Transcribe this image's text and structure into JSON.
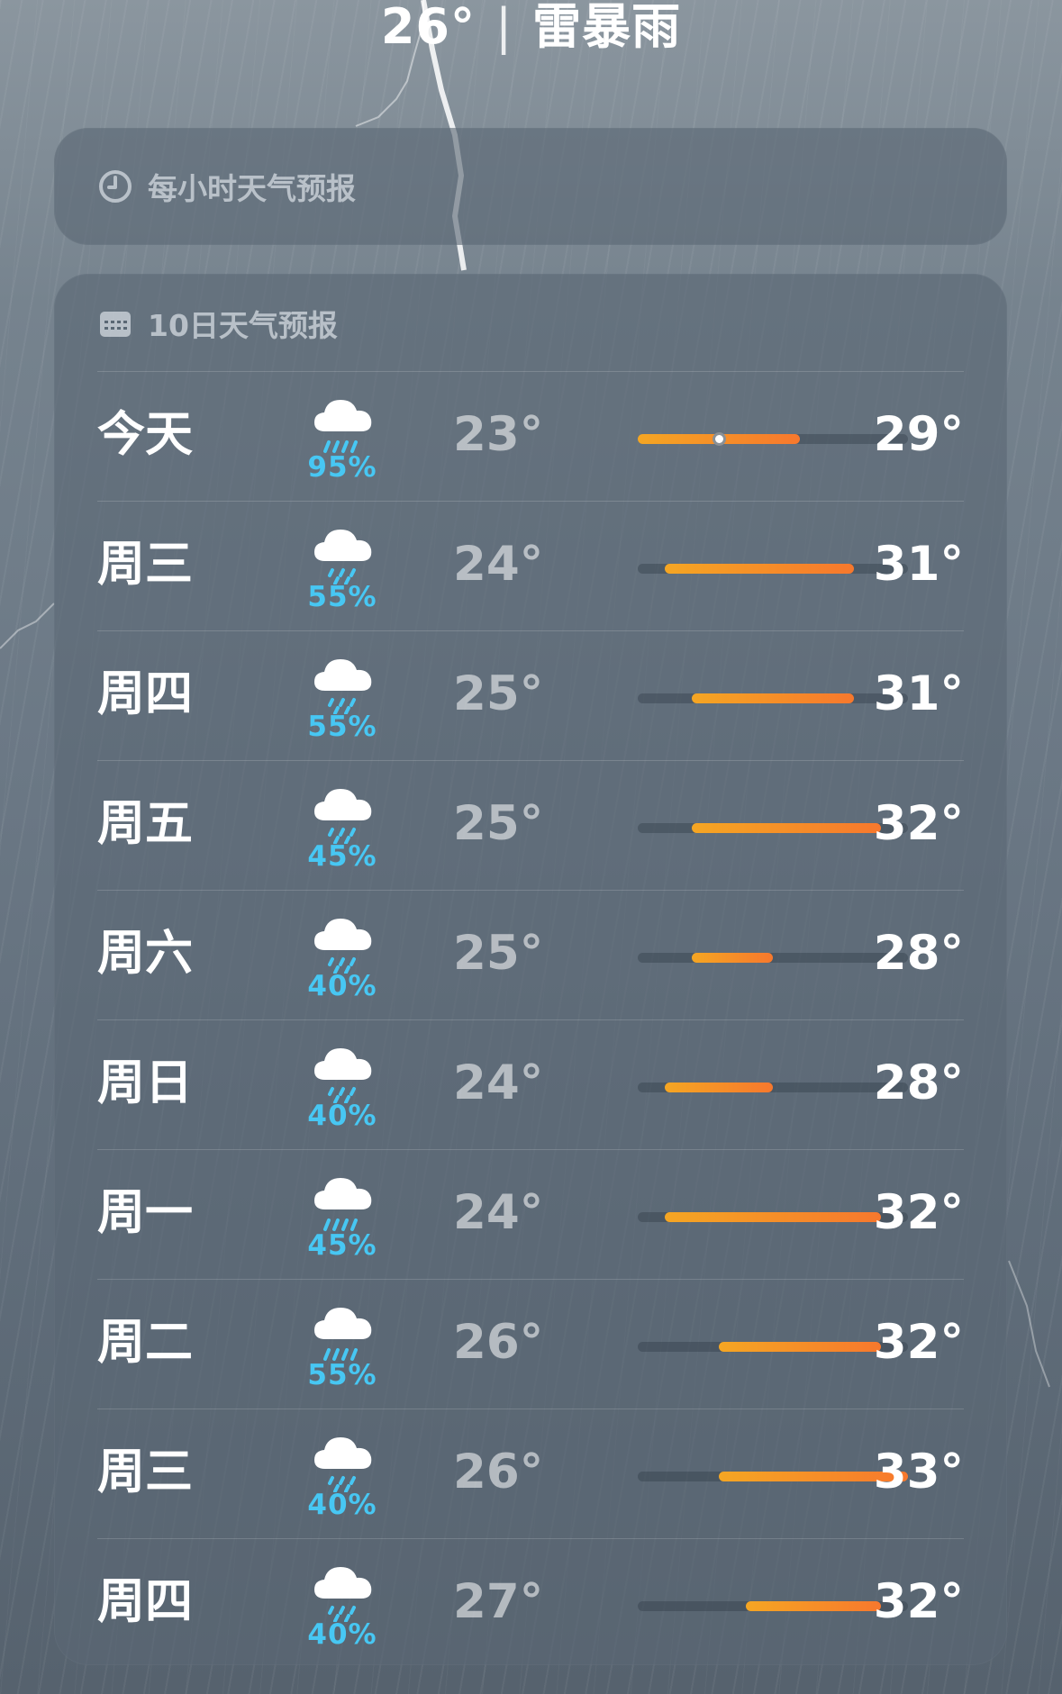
{
  "header": {
    "temperature": "26°",
    "separator": "|",
    "condition": "雷暴雨"
  },
  "hourly_card": {
    "title": "每小时天气预报",
    "icon": "clock-icon"
  },
  "daily_card": {
    "title": "10日天气预报",
    "icon": "calendar-icon",
    "range_min": 23,
    "range_max": 33,
    "current_temp": 26,
    "days": [
      {
        "day": "今天",
        "icon": "cloud-rain-heavy-icon",
        "precip": "95%",
        "low": "23°",
        "high": "29°",
        "low_val": 23,
        "high_val": 29,
        "current": true
      },
      {
        "day": "周三",
        "icon": "cloud-rain-icon",
        "precip": "55%",
        "low": "24°",
        "high": "31°",
        "low_val": 24,
        "high_val": 31
      },
      {
        "day": "周四",
        "icon": "cloud-rain-icon",
        "precip": "55%",
        "low": "25°",
        "high": "31°",
        "low_val": 25,
        "high_val": 31
      },
      {
        "day": "周五",
        "icon": "cloud-rain-icon",
        "precip": "45%",
        "low": "25°",
        "high": "32°",
        "low_val": 25,
        "high_val": 32
      },
      {
        "day": "周六",
        "icon": "cloud-rain-icon",
        "precip": "40%",
        "low": "25°",
        "high": "28°",
        "low_val": 25,
        "high_val": 28
      },
      {
        "day": "周日",
        "icon": "cloud-rain-icon",
        "precip": "40%",
        "low": "24°",
        "high": "28°",
        "low_val": 24,
        "high_val": 28
      },
      {
        "day": "周一",
        "icon": "cloud-rain-heavy-icon",
        "precip": "45%",
        "low": "24°",
        "high": "32°",
        "low_val": 24,
        "high_val": 32
      },
      {
        "day": "周二",
        "icon": "cloud-rain-heavy-icon",
        "precip": "55%",
        "low": "26°",
        "high": "32°",
        "low_val": 26,
        "high_val": 32
      },
      {
        "day": "周三",
        "icon": "cloud-rain-icon",
        "precip": "40%",
        "low": "26°",
        "high": "33°",
        "low_val": 26,
        "high_val": 33
      },
      {
        "day": "周四",
        "icon": "cloud-rain-icon",
        "precip": "40%",
        "low": "27°",
        "high": "32°",
        "low_val": 27,
        "high_val": 32
      }
    ]
  },
  "colors": {
    "precip_text": "#47c7f3",
    "bar_start": "#f5a623",
    "bar_end": "#f7782d"
  }
}
